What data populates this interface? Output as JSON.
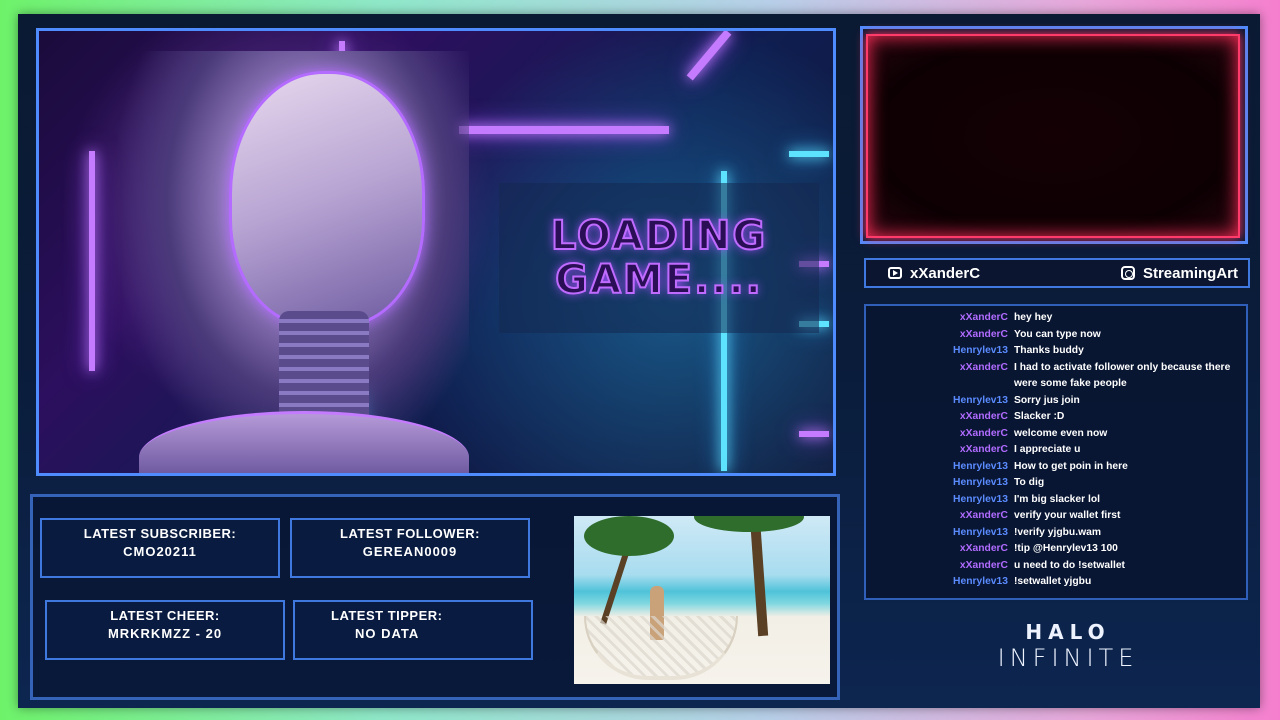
{
  "game": {
    "loading_line1": "LOADING",
    "loading_line2": "GAME...."
  },
  "socials": {
    "youtube": "xXanderC",
    "instagram": "StreamingArt"
  },
  "chat": [
    {
      "user": "xXanderC",
      "text": "hey hey",
      "color": "#b06bff"
    },
    {
      "user": "xXanderC",
      "text": "You can type now",
      "color": "#b06bff"
    },
    {
      "user": "Henrylev13",
      "text": "Thanks buddy",
      "color": "#5a8bff"
    },
    {
      "user": "xXanderC",
      "text": "I had to activate follower only because there were some fake people",
      "color": "#b06bff"
    },
    {
      "user": "Henrylev13",
      "text": "Sorry jus join",
      "color": "#5a8bff"
    },
    {
      "user": "xXanderC",
      "text": "Slacker :D",
      "color": "#b06bff"
    },
    {
      "user": "xXanderC",
      "text": "welcome even now",
      "color": "#b06bff"
    },
    {
      "user": "xXanderC",
      "text": "I appreciate u",
      "color": "#b06bff"
    },
    {
      "user": "Henrylev13",
      "text": "How to get poin in here",
      "color": "#5a8bff"
    },
    {
      "user": "Henrylev13",
      "text": "To dig",
      "color": "#5a8bff"
    },
    {
      "user": "Henrylev13",
      "text": "I'm big slacker lol",
      "color": "#5a8bff"
    },
    {
      "user": "xXanderC",
      "text": "verify your wallet first",
      "color": "#b06bff"
    },
    {
      "user": "Henrylev13",
      "text": "!verify yjgbu.wam",
      "color": "#5a8bff"
    },
    {
      "user": "xXanderC",
      "text": "!tip @Henrylev13 100",
      "color": "#b06bff"
    },
    {
      "user": "xXanderC",
      "text": "u need to do !setwallet",
      "color": "#b06bff"
    },
    {
      "user": "Henrylev13",
      "text": "!setwallet yjgbu",
      "color": "#5a8bff"
    }
  ],
  "alerts": {
    "subscriber": {
      "label": "LATEST SUBSCRIBER:",
      "value": "CMO20211"
    },
    "follower": {
      "label": "LATEST FOLLOWER:",
      "value": "GEREAN0009"
    },
    "cheer": {
      "label": "LATEST CHEER:",
      "value": "MRKRKMZZ - 20"
    },
    "tipper": {
      "label": "LATEST TIPPER:",
      "value": "NO DATA"
    }
  },
  "halo": {
    "line1": "HALO",
    "line2": "INFINITE"
  },
  "colors": {
    "accent_blue": "#4f8cff",
    "neon_purple": "#c47bff",
    "cam_red": "#ff3b6b"
  }
}
